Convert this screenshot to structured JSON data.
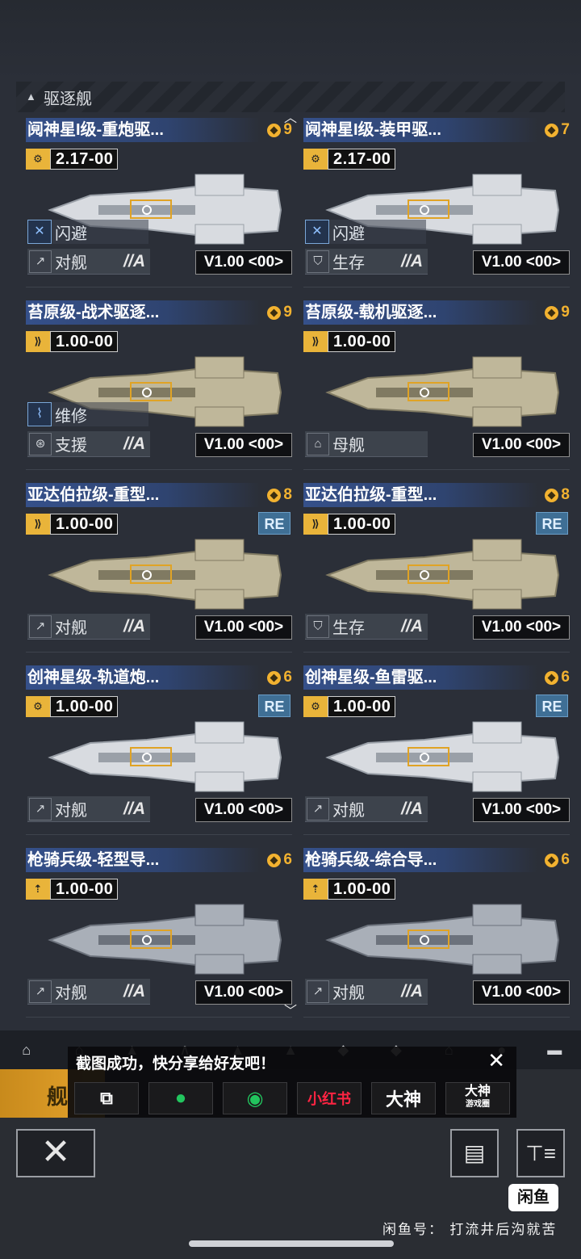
{
  "section": {
    "label": "驱逐舰"
  },
  "ships": [
    {
      "title": "阋神星I级-重炮驱...",
      "rank": "9",
      "cost": "2.17-00",
      "cost_icon": "gear-icon",
      "trait": "闪避",
      "trait_icon": "dodge-icon",
      "role": "对舰",
      "role_icon": "anti-ship-icon",
      "grade": "//A",
      "version": "V1.00 <00>",
      "re": "",
      "hull": "white"
    },
    {
      "title": "阋神星I级-装甲驱...",
      "rank": "7",
      "cost": "2.17-00",
      "cost_icon": "gear-icon",
      "trait": "闪避",
      "trait_icon": "dodge-icon",
      "role": "生存",
      "role_icon": "shield-icon",
      "grade": "//A",
      "version": "V1.00 <00>",
      "re": "",
      "hull": "white"
    },
    {
      "title": "苔原级-战术驱逐...",
      "rank": "9",
      "cost": "1.00-00",
      "cost_icon": "speed-icon",
      "trait": "维修",
      "trait_icon": "repair-icon",
      "role": "支援",
      "role_icon": "support-icon",
      "grade": "//A",
      "version": "V1.00 <00>",
      "re": "",
      "hull": "olive"
    },
    {
      "title": "苔原级-载机驱逐...",
      "rank": "9",
      "cost": "1.00-00",
      "cost_icon": "speed-icon",
      "trait": "",
      "trait_icon": "",
      "role": "母舰",
      "role_icon": "carrier-icon",
      "grade": "",
      "version": "V1.00 <00>",
      "re": "",
      "hull": "olive"
    },
    {
      "title": "亚达伯拉级-重型...",
      "rank": "8",
      "cost": "1.00-00",
      "cost_icon": "speed-icon",
      "trait": "",
      "trait_icon": "",
      "role": "对舰",
      "role_icon": "anti-ship-icon",
      "grade": "//A",
      "version": "V1.00 <00>",
      "re": "RE",
      "hull": "olive"
    },
    {
      "title": "亚达伯拉级-重型...",
      "rank": "8",
      "cost": "1.00-00",
      "cost_icon": "speed-icon",
      "trait": "",
      "trait_icon": "",
      "role": "生存",
      "role_icon": "shield-icon",
      "grade": "//A",
      "version": "V1.00 <00>",
      "re": "RE",
      "hull": "olive"
    },
    {
      "title": "创神星级-轨道炮...",
      "rank": "6",
      "cost": "1.00-00",
      "cost_icon": "gear-icon",
      "trait": "",
      "trait_icon": "",
      "role": "对舰",
      "role_icon": "anti-ship-icon",
      "grade": "//A",
      "version": "V1.00 <00>",
      "re": "RE",
      "hull": "white"
    },
    {
      "title": "创神星级-鱼雷驱...",
      "rank": "6",
      "cost": "1.00-00",
      "cost_icon": "gear-icon",
      "trait": "",
      "trait_icon": "",
      "role": "对舰",
      "role_icon": "anti-ship-icon",
      "grade": "//A",
      "version": "V1.00 <00>",
      "re": "RE",
      "hull": "white"
    },
    {
      "title": "枪骑兵级-轻型导...",
      "rank": "6",
      "cost": "1.00-00",
      "cost_icon": "missile-icon",
      "trait": "",
      "trait_icon": "",
      "role": "对舰",
      "role_icon": "anti-ship-icon",
      "grade": "//A",
      "version": "V1.00 <00>",
      "re": "",
      "hull": "grey"
    },
    {
      "title": "枪骑兵级-综合导...",
      "rank": "6",
      "cost": "1.00-00",
      "cost_icon": "missile-icon",
      "trait": "",
      "trait_icon": "",
      "role": "对舰",
      "role_icon": "anti-ship-icon",
      "grade": "//A",
      "version": "V1.00 <00>",
      "re": "",
      "hull": "grey"
    }
  ],
  "active_tab": {
    "label": "舰"
  },
  "share": {
    "message": "截图成功，快分享给好友吧！",
    "close": "✕",
    "buttons": [
      {
        "name": "screenshot-share",
        "label": "⧉"
      },
      {
        "name": "wechat",
        "label": "●"
      },
      {
        "name": "moments",
        "label": "◉"
      },
      {
        "name": "xiaohongshu",
        "label": "小红书"
      },
      {
        "name": "dashen",
        "label": "大神"
      },
      {
        "name": "dashen-circle",
        "label": "大神",
        "sub": "游戏圈"
      }
    ]
  },
  "footer": {
    "close": "✕",
    "list": "▤",
    "filter": "⊤≡",
    "xianyu": "闲鱼",
    "watermark": "闲鱼号： 打流井后沟就苦"
  }
}
